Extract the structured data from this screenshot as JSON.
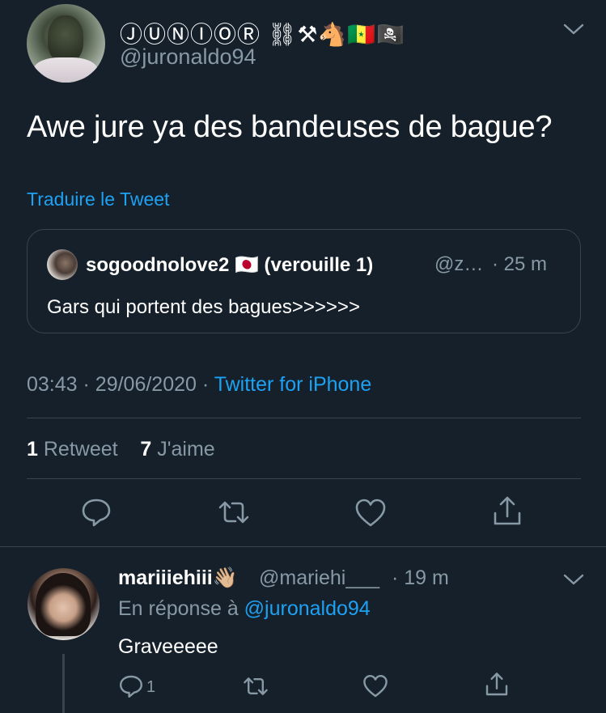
{
  "tweet": {
    "display_name": "ⒿⓊⓃⒾⓄⓇ ⛓⚒🐴🇸🇳🏴‍☠️",
    "handle": "@juronaldo94",
    "text": "Awe jure ya des bandeuses de bague?",
    "translate_label": "Traduire le Tweet",
    "quote": {
      "name": "sogoodnolove2 🇯🇵 (verouille 1)",
      "handle": "@z…",
      "time": "· 25 m",
      "text": "Gars qui portent des bagues>>>>>>"
    },
    "time": "03:43",
    "date": "29/06/2020",
    "separator": "·",
    "source": "Twitter for iPhone",
    "retweets_count": "1",
    "retweets_label": "Retweet",
    "likes_count": "7",
    "likes_label": "J'aime"
  },
  "reply": {
    "name": "mariiiehiii👋🏼",
    "handle": "@mariehi___",
    "time": "· 19 m",
    "reply_prefix": "En réponse à",
    "reply_to": "@juronaldo94",
    "text": "Graveeeee",
    "reply_count": "1"
  },
  "icons": {
    "more": "chevron-down-icon",
    "reply": "comment-icon",
    "retweet": "retweet-icon",
    "like": "heart-icon",
    "share": "share-icon"
  },
  "colors": {
    "background": "#15202b",
    "accent": "#1da1f2",
    "secondary_text": "#8899a6",
    "border": "#38444d"
  }
}
